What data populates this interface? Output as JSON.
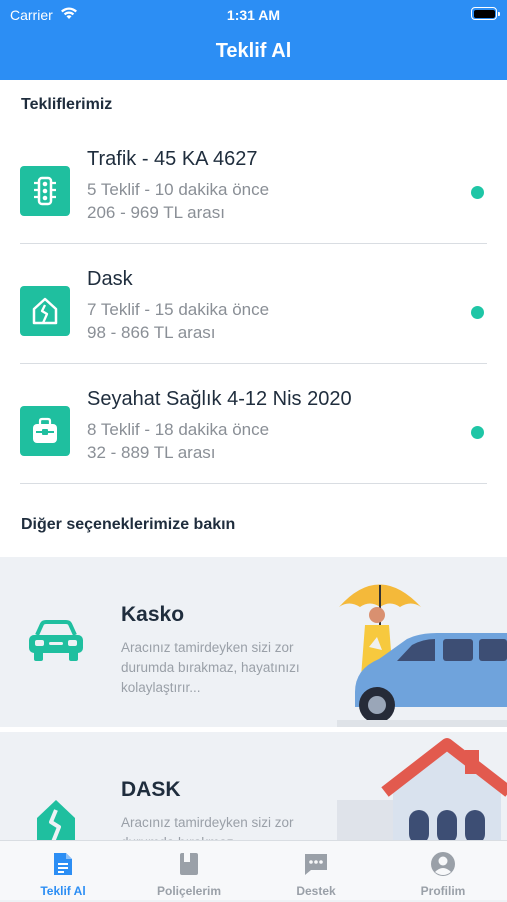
{
  "status_bar": {
    "carrier": "Carrier",
    "time": "1:31 AM"
  },
  "nav": {
    "title": "Teklif Al"
  },
  "offers_section": {
    "title": "Tekliflerimiz"
  },
  "offers": [
    {
      "name": "Trafik - 45 KA 4627",
      "count_time": "5 Teklif - 10 dakika önce",
      "range": "206 - 969 TL arası",
      "icon": "traffic-light-icon"
    },
    {
      "name": "Dask",
      "count_time": "7 Teklif - 15 dakika önce",
      "range": "98 - 866 TL arası",
      "icon": "house-crack-icon"
    },
    {
      "name": "Seyahat Sağlık 4-12 Nis 2020",
      "count_time": "8 Teklif - 18 dakika önce",
      "range": "32 - 889 TL arası",
      "icon": "luggage-icon"
    }
  ],
  "options_section": {
    "title": "Diğer seçeneklerimize bakın"
  },
  "options": [
    {
      "title": "Kasko",
      "desc": "Aracınız tamirdeyken sizi zor durumda bırakmaz, hayatınızı kolaylaştırır...",
      "icon": "car-icon"
    },
    {
      "title": "DASK",
      "desc": "Aracınız tamirdeyken sizi zor durumda bırakmaz",
      "icon": "house-crack-icon"
    }
  ],
  "tabs": [
    {
      "label": "Teklif Al",
      "icon": "document-icon",
      "active": true
    },
    {
      "label": "Poliçelerim",
      "icon": "book-icon",
      "active": false
    },
    {
      "label": "Destek",
      "icon": "chat-icon",
      "active": false
    },
    {
      "label": "Profilim",
      "icon": "user-icon",
      "active": false
    }
  ],
  "colors": {
    "primary": "#2c8ef4",
    "accent": "#1fbf9f",
    "muted": "#8a8f96"
  }
}
